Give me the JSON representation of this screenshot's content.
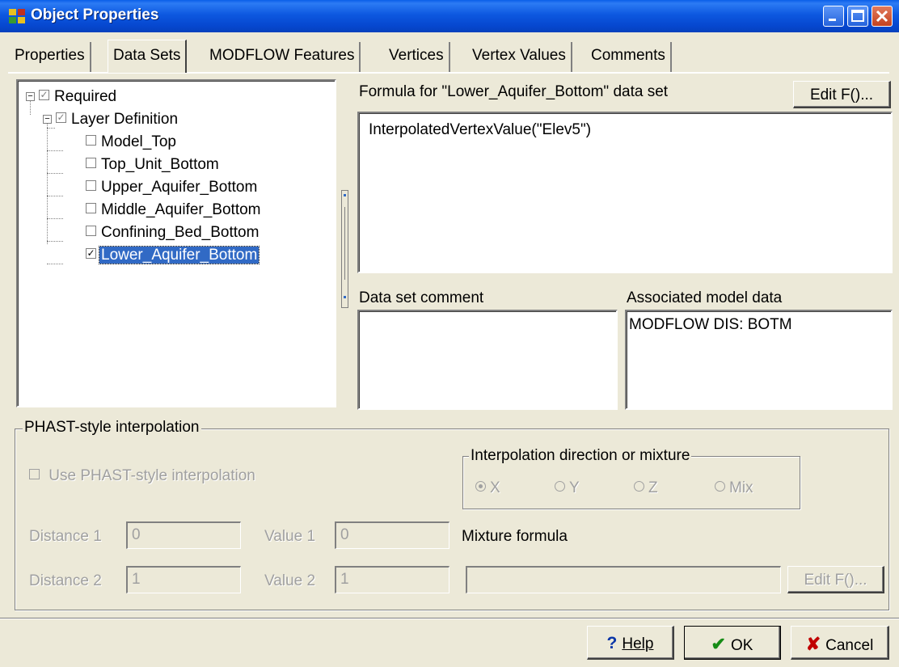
{
  "window": {
    "title": "Object Properties",
    "icon": "app-grid-icon"
  },
  "tabs": [
    {
      "label": "Properties",
      "active": false
    },
    {
      "label": "Data Sets",
      "active": true
    },
    {
      "label": "MODFLOW Features",
      "active": false
    },
    {
      "label": "Vertices",
      "active": false
    },
    {
      "label": "Vertex Values",
      "active": false
    },
    {
      "label": "Comments",
      "active": false
    }
  ],
  "tree": {
    "root": {
      "label": "Required",
      "checked": true
    },
    "group": {
      "label": "Layer Definition",
      "checked": true
    },
    "items": [
      {
        "label": "Model_Top",
        "checked": false
      },
      {
        "label": "Top_Unit_Bottom",
        "checked": false
      },
      {
        "label": "Upper_Aquifer_Bottom",
        "checked": false
      },
      {
        "label": "Middle_Aquifer_Bottom",
        "checked": false
      },
      {
        "label": "Confining_Bed_Bottom",
        "checked": false
      },
      {
        "label": "Lower_Aquifer_Bottom",
        "checked": true,
        "selected": true
      }
    ]
  },
  "formula": {
    "label": "Formula for \"Lower_Aquifer_Bottom\" data set",
    "edit_button": "Edit F()...",
    "value": "InterpolatedVertexValue(\"Elev5\")"
  },
  "comment": {
    "label": "Data set comment",
    "value": ""
  },
  "associated": {
    "label": "Associated model data",
    "value": "MODFLOW DIS: BOTM"
  },
  "phast": {
    "group_label": "PHAST-style interpolation",
    "use_checkbox_label": "Use PHAST-style interpolation",
    "interp_group_label": "Interpolation direction or mixture",
    "directions": [
      {
        "label": "X",
        "selected": true
      },
      {
        "label": "Y",
        "selected": false
      },
      {
        "label": "Z",
        "selected": false
      },
      {
        "label": "Mix",
        "selected": false
      }
    ],
    "distance1_label": "Distance 1",
    "distance1_value": "0",
    "value1_label": "Value 1",
    "value1_value": "0",
    "distance2_label": "Distance 2",
    "distance2_value": "1",
    "value2_label": "Value 2",
    "value2_value": "1",
    "mixture_label": "Mixture formula",
    "mixture_value": "",
    "mixture_edit_button": "Edit F()..."
  },
  "footer": {
    "help_label": "Help",
    "ok_label": "OK",
    "cancel_label": "Cancel"
  }
}
